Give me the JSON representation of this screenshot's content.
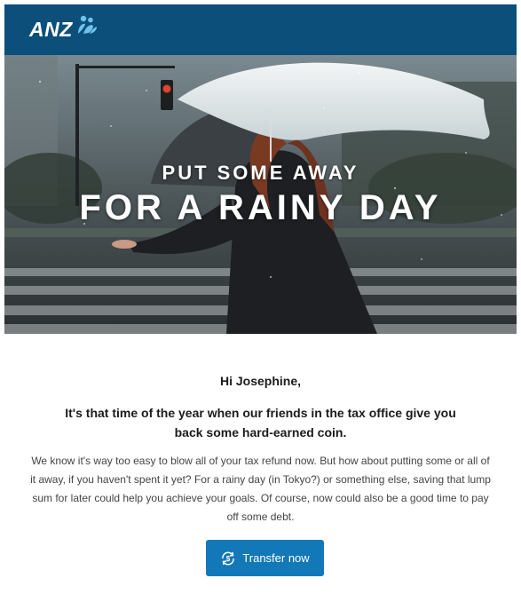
{
  "brand": {
    "name": "ANZ",
    "header_color": "#0b4f7a",
    "accent_color": "#1378b8"
  },
  "hero": {
    "line1": "PUT SOME AWAY",
    "line2": "FOR A RAINY DAY",
    "image_icon": "rain-umbrella-photo"
  },
  "content": {
    "greeting": "Hi Josephine,",
    "lead": "It's that time of the year when our friends in the tax office give you back some hard-earned coin.",
    "paragraph": "We know it's way too easy to blow all of your tax refund now. But how about putting some or all of it away, if you haven't spent it yet? For a rainy day (in Tokyo?) or something else, saving that lump sum for later could help you achieve your goals. Of course, now could also be a good time to pay off some debt."
  },
  "cta": {
    "label": "Transfer now",
    "icon": "transfer-dollar-icon"
  }
}
